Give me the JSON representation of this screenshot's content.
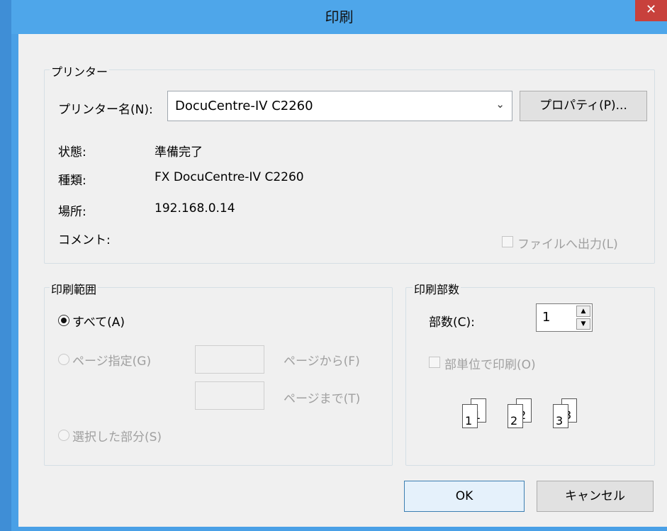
{
  "dialog": {
    "title": "印刷",
    "close_glyph": "✕"
  },
  "printer": {
    "group_label": "プリンター",
    "name_label": "プリンター名(N):",
    "name_value": "DocuCentre-IV C2260",
    "properties_button": "プロパティ(P)...",
    "status_label": "状態:",
    "status_value": "準備完了",
    "type_label": "種類:",
    "type_value": "FX DocuCentre-IV C2260",
    "location_label": "場所:",
    "location_value": "192.168.0.14",
    "comment_label": "コメント:",
    "comment_value": "",
    "print_to_file_label": "ファイルへ出力(L)"
  },
  "range": {
    "group_label": "印刷範囲",
    "all_label": "すべて(A)",
    "pages_label": "ページ指定(G)",
    "from_label": "ページから(F)",
    "to_label": "ページまで(T)",
    "from_value": "",
    "to_value": "",
    "selection_label": "選択した部分(S)"
  },
  "copies": {
    "group_label": "印刷部数",
    "count_label": "部数(C):",
    "count_value": "1",
    "collate_label": "部単位で印刷(O)",
    "collate_pages": [
      "1",
      "1",
      "2",
      "2",
      "3",
      "3"
    ]
  },
  "buttons": {
    "ok": "OK",
    "cancel": "キャンセル"
  }
}
